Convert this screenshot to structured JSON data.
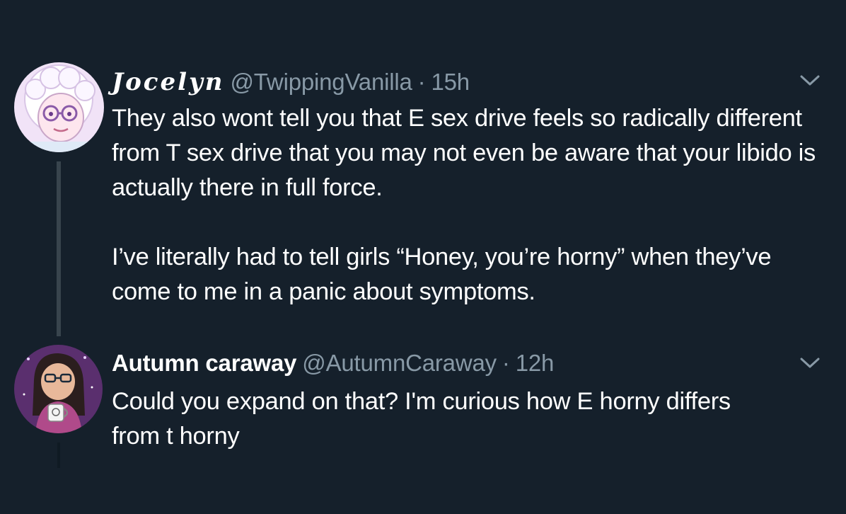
{
  "tweets": [
    {
      "display_name": "Jocelyn",
      "handle": "@TwippingVanilla",
      "separator": "·",
      "time": "15h",
      "text": "They also wont tell you that E sex drive feels so radically different from T sex drive that you may not even be aware that your libido is actually there in full force.\n\nI’ve literally had to tell girls “Honey, you’re horny” when they’ve come to me in a panic about symptoms.",
      "avatar_icon": "cartoon-woman-avatar",
      "menu_icon": "chevron-down-icon"
    },
    {
      "display_name": "Autumn caraway",
      "handle": "@AutumnCaraway",
      "separator": "·",
      "time": "12h",
      "text": "Could you expand on that? I'm curious how E horny differs from t horny",
      "avatar_icon": "cartoon-girl-with-mug-avatar",
      "menu_icon": "chevron-down-icon"
    }
  ],
  "colors": {
    "background": "#15202b",
    "text": "#ffffff",
    "secondary_text": "#8899a6",
    "thread_line": "#38444d"
  }
}
